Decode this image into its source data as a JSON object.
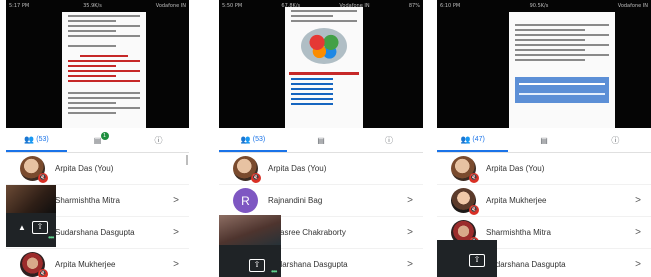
{
  "panels": [
    {
      "status": {
        "time": "5:17 PM",
        "speed": "35.9K/s",
        "carrier": "Vodafone IN"
      },
      "tabs": {
        "people_count": "(53)",
        "chat_badge": "1"
      },
      "participants": [
        {
          "name": "Arpita Das (You)",
          "chevron": ""
        },
        {
          "name": "Sharmishtha Mitra",
          "chevron": ">"
        },
        {
          "name": "Sudarshana Dasgupta",
          "chevron": ">"
        },
        {
          "name": "Arpita Mukherjee",
          "chevron": ">"
        }
      ]
    },
    {
      "status": {
        "time": "5:50 PM",
        "speed": "67.8K/s",
        "carrier": "Vodafone IN",
        "battery": "87%"
      },
      "tabs": {
        "people_count": "(53)"
      },
      "participants": [
        {
          "name": "Arpita Das (You)",
          "chevron": ""
        },
        {
          "name": "Rajnandini Bag",
          "chevron": ">",
          "initial": "R"
        },
        {
          "name": "Rajasree Chakraborty",
          "chevron": ">"
        },
        {
          "name": "Sudarshana Dasgupta",
          "chevron": ">"
        }
      ]
    },
    {
      "status": {
        "time": "6:10 PM",
        "speed": "90.5K/s",
        "carrier": "Vodafone IN"
      },
      "tabs": {
        "people_count": "(47)"
      },
      "participants": [
        {
          "name": "Arpita Das (You)",
          "chevron": ""
        },
        {
          "name": "Arpita Mukherjee",
          "chevron": ">"
        },
        {
          "name": "Sharmishtha Mitra",
          "chevron": ">"
        },
        {
          "name": "Sudarshana Dasgupta",
          "chevron": ">"
        }
      ]
    }
  ],
  "icons": {
    "people": "people-icon",
    "chat": "chat-icon",
    "info": "info-icon",
    "mute": "mic-off-icon",
    "present": "present-icon"
  },
  "colors": {
    "accent": "#1a73e8",
    "mute_red": "#d93025",
    "badge_green": "#1e8e3e"
  }
}
